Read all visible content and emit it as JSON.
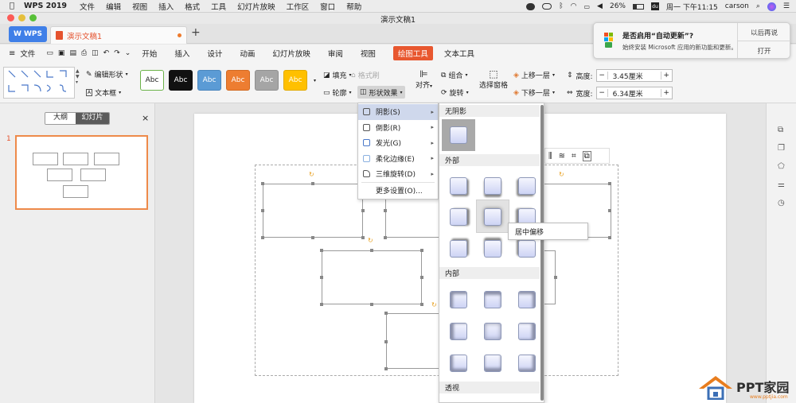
{
  "macmenu": {
    "apple": "",
    "app": "WPS 2019",
    "items": [
      "文件",
      "编辑",
      "视图",
      "插入",
      "格式",
      "工具",
      "幻灯片放映",
      "工作区",
      "窗口",
      "帮助"
    ],
    "battery": "26%",
    "clock": "周一 下午11:15",
    "user": "carson"
  },
  "window": {
    "title": "演示文稿1"
  },
  "tabs": {
    "wps": "WPS",
    "doc": "演示文稿1",
    "add": "+"
  },
  "menurow": {
    "file": "文件",
    "tabs": [
      "开始",
      "插入",
      "设计",
      "动画",
      "幻灯片放映",
      "审阅",
      "视图",
      "绘图工具",
      "文本工具"
    ],
    "active": "绘图工具"
  },
  "ribbon": {
    "edit_shape": "编辑形状",
    "textbox": "文本框",
    "abc": "Abc",
    "fill": "填充",
    "format_brush": "格式刷",
    "outline": "轮廓",
    "shape_effect": "形状效果",
    "align": "对齐",
    "group": "组合",
    "rotate": "旋转",
    "select_pane": "选择窗格",
    "bring_forward": "上移一层",
    "send_backward": "下移一层",
    "height_label": "高度:",
    "height_value": "3.45厘米",
    "width_label": "宽度:",
    "width_value": "6.34厘米",
    "minus": "−",
    "plus": "+"
  },
  "styles": [
    {
      "bg": "#ffffff",
      "fg": "#222222",
      "border": "#6cb34a"
    },
    {
      "bg": "#111111",
      "fg": "#ffffff",
      "border": "#111111"
    },
    {
      "bg": "#5b9bd5",
      "fg": "#ffffff",
      "border": "#4a86bd"
    },
    {
      "bg": "#ed7d31",
      "fg": "#ffffff",
      "border": "#d26a22"
    },
    {
      "bg": "#a5a5a5",
      "fg": "#ffffff",
      "border": "#909090"
    },
    {
      "bg": "#ffc000",
      "fg": "#ffffff",
      "border": "#e2aa00"
    }
  ],
  "leftpanel": {
    "outline_tab": "大纲",
    "slides_tab": "幻灯片",
    "close": "×",
    "slide_number": "1"
  },
  "effect_menu": [
    {
      "label": "阴影(S)",
      "arrow": "▸"
    },
    {
      "label": "倒影(R)",
      "arrow": "▸"
    },
    {
      "label": "发光(G)",
      "arrow": "▸"
    },
    {
      "label": "柔化边缘(E)",
      "arrow": "▸"
    },
    {
      "label": "三维旋转(D)",
      "arrow": "▸"
    },
    {
      "label": "更多设置(O)...",
      "arrow": ""
    }
  ],
  "shadow_menu": {
    "none": "无阴影",
    "outer": "外部",
    "inner": "内部",
    "perspective": "透视"
  },
  "tooltip": "居中偏移",
  "notification": {
    "title": "是否启用“自动更新”?",
    "body": "始终安装 Microsoft 应用的新功能和更新。",
    "later": "以后再说",
    "open": "打开"
  },
  "watermark": {
    "brand": "PPT家园",
    "url": "www.pptjia.com"
  }
}
